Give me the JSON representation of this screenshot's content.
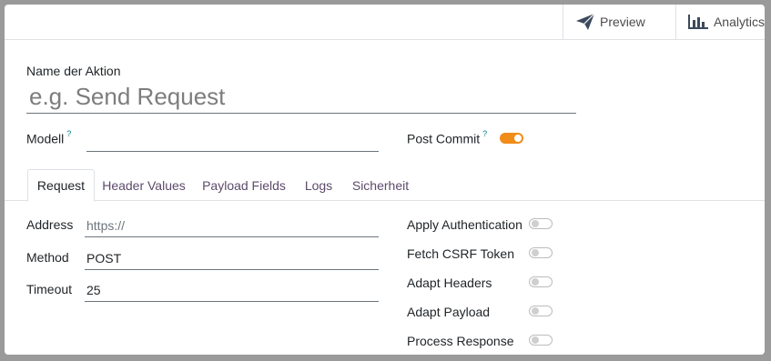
{
  "header": {
    "preview_label": "Preview",
    "analytics_label": "Analytics"
  },
  "form": {
    "name_label": "Name der Aktion",
    "name_placeholder": "e.g. Send Request",
    "model_label": "Modell",
    "model_help": "?",
    "model_value": "",
    "post_commit_label": "Post Commit",
    "post_commit_help": "?",
    "post_commit_enabled": true,
    "accent_color": "#f08c19"
  },
  "tabs": [
    {
      "label": "Request",
      "active": true
    },
    {
      "label": "Header Values",
      "active": false
    },
    {
      "label": "Payload Fields",
      "active": false
    },
    {
      "label": "Logs",
      "active": false
    },
    {
      "label": "Sicherheit",
      "active": false
    }
  ],
  "request": {
    "address_label": "Address",
    "address_placeholder": "https://",
    "method_label": "Method",
    "method_value": "POST",
    "timeout_label": "Timeout",
    "timeout_value": "25"
  },
  "options": [
    {
      "label": "Apply Authentication",
      "enabled": false
    },
    {
      "label": "Fetch CSRF Token",
      "enabled": false
    },
    {
      "label": "Adapt Headers",
      "enabled": false
    },
    {
      "label": "Adapt Payload",
      "enabled": false
    },
    {
      "label": "Process Response",
      "enabled": false
    }
  ]
}
